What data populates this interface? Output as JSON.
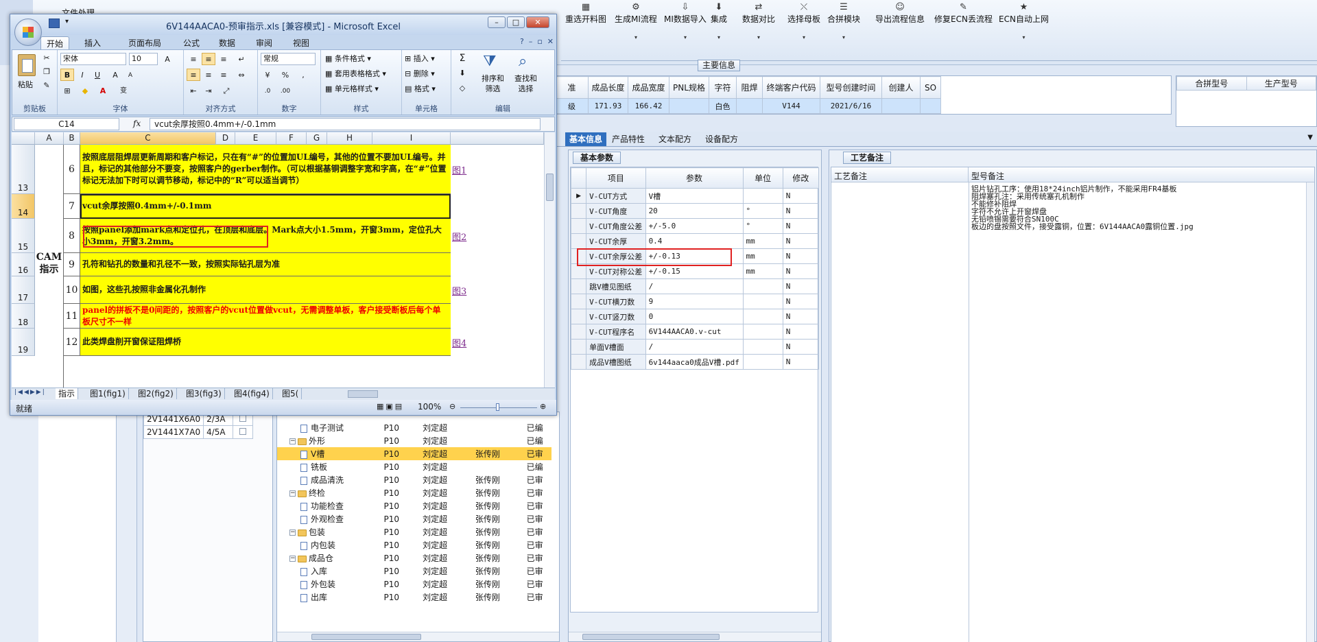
{
  "bg_app": {
    "menu_label": "文件处理",
    "toolbar": [
      "重选开料图",
      "生成MI流程",
      "MI数据导入",
      "集成",
      "数据对比",
      "选择母板",
      "合拼模块",
      "导出流程信息",
      "修复ECN丢流程",
      "ECN自动上网"
    ],
    "main_info_label": "主要信息",
    "info_headers": [
      "准",
      "成品长度",
      "成品宽度",
      "PNL规格",
      "字符",
      "阻焊",
      "终端客户代码",
      "型号创建时间",
      "创建人",
      "SO"
    ],
    "info_row": [
      "级",
      "171.93",
      "166.42",
      "",
      "白色",
      "",
      "V144",
      "2021/6/16",
      "",
      ""
    ],
    "right_headers": [
      "合拼型号",
      "生产型号"
    ],
    "detail_tabs": [
      "基本信息",
      "产品特性",
      "文本配方",
      "设备配方"
    ],
    "basic_params_title": "基本参数",
    "params_headers": [
      "项目",
      "参数",
      "单位",
      "修改"
    ],
    "params": [
      [
        "V-CUT方式",
        "V槽",
        "",
        "N"
      ],
      [
        "V-CUT角度",
        "20",
        "°",
        "N"
      ],
      [
        "V-CUT角度公差",
        "+/-5.0",
        "°",
        "N"
      ],
      [
        "V-CUT余厚",
        "0.4",
        "mm",
        "N"
      ],
      [
        "V-CUT余厚公差",
        "+/-0.13",
        "mm",
        "N"
      ],
      [
        "V-CUT对称公差",
        "+/-0.15",
        "mm",
        "N"
      ],
      [
        "跳V槽见图纸",
        "/",
        "",
        "N"
      ],
      [
        "V-CUT横刀数",
        "9",
        "",
        "N"
      ],
      [
        "V-CUT竖刀数",
        "0",
        "",
        "N"
      ],
      [
        "V-CUT程序名",
        "6V144AACA0.v-cut",
        "",
        "N"
      ],
      [
        "单面V槽面",
        "/",
        "",
        "N"
      ],
      [
        "成品V槽图纸",
        "6v144aaca0成品V槽.pdf",
        "",
        "N"
      ]
    ],
    "craft_title": "工艺备注",
    "craft_headers": [
      "工艺备注",
      "型号备注"
    ],
    "model_notes": [
      "铝片钻孔工序：使用18*24inch铝片制作，不能采用FR4基板",
      "阻焊塞孔注：采用传统塞孔机制作",
      "不能修补阻焊",
      "字符不允许上开窗焊盘",
      "无铅喷锡需要符合SN100C",
      "板边的盘按照文件，接受露铜，位置：6V144AACA0露铜位置.jpg"
    ],
    "small_rows": [
      [
        "2V1441X6A0",
        "2/3A"
      ],
      [
        "2V1441X7A0",
        "4/5A"
      ]
    ],
    "tree": [
      {
        "name": "电子测试",
        "lvl": 2,
        "c1": "P10",
        "c2": "刘定超",
        "c3": "",
        "c4": "已编",
        "hl": false
      },
      {
        "name": "外形",
        "lvl": 1,
        "c1": "P10",
        "c2": "刘定超",
        "c3": "",
        "c4": "已编",
        "hl": false
      },
      {
        "name": "V槽",
        "lvl": 2,
        "c1": "P10",
        "c2": "刘定超",
        "c3": "张传刚",
        "c4": "已审",
        "hl": true
      },
      {
        "name": "铣板",
        "lvl": 2,
        "c1": "P10",
        "c2": "刘定超",
        "c3": "",
        "c4": "已编",
        "hl": false
      },
      {
        "name": "成品清洗",
        "lvl": 2,
        "c1": "P10",
        "c2": "刘定超",
        "c3": "张传刚",
        "c4": "已审",
        "hl": false
      },
      {
        "name": "终检",
        "lvl": 1,
        "c1": "P10",
        "c2": "刘定超",
        "c3": "张传刚",
        "c4": "已审",
        "hl": false
      },
      {
        "name": "功能检查",
        "lvl": 2,
        "c1": "P10",
        "c2": "刘定超",
        "c3": "张传刚",
        "c4": "已审",
        "hl": false
      },
      {
        "name": "外观检查",
        "lvl": 2,
        "c1": "P10",
        "c2": "刘定超",
        "c3": "张传刚",
        "c4": "已审",
        "hl": false
      },
      {
        "name": "包装",
        "lvl": 1,
        "c1": "P10",
        "c2": "刘定超",
        "c3": "张传刚",
        "c4": "已审",
        "hl": false
      },
      {
        "name": "内包装",
        "lvl": 2,
        "c1": "P10",
        "c2": "刘定超",
        "c3": "张传刚",
        "c4": "已审",
        "hl": false
      },
      {
        "name": "成品仓",
        "lvl": 1,
        "c1": "P10",
        "c2": "刘定超",
        "c3": "张传刚",
        "c4": "已审",
        "hl": false
      },
      {
        "name": "入库",
        "lvl": 2,
        "c1": "P10",
        "c2": "刘定超",
        "c3": "张传刚",
        "c4": "已审",
        "hl": false
      },
      {
        "name": "外包装",
        "lvl": 2,
        "c1": "P10",
        "c2": "刘定超",
        "c3": "张传刚",
        "c4": "已审",
        "hl": false
      },
      {
        "name": "出库",
        "lvl": 2,
        "c1": "P10",
        "c2": "刘定超",
        "c3": "张传刚",
        "c4": "已审",
        "hl": false
      }
    ]
  },
  "excel": {
    "title": "6V144AACA0-预审指示.xls  [兼容模式] - Microsoft Excel",
    "tabs": [
      "开始",
      "插入",
      "页面布局",
      "公式",
      "数据",
      "审阅",
      "视图"
    ],
    "clipboard": {
      "paste": "粘贴",
      "label": "剪贴板"
    },
    "font": {
      "name": "宋体",
      "size": "10",
      "label": "字体"
    },
    "align_label": "对齐方式",
    "number": {
      "format": "常规",
      "label": "数字",
      "pct": "%"
    },
    "styles": {
      "items": [
        "条件格式",
        "套用表格格式",
        "单元格样式"
      ],
      "label": "样式"
    },
    "cells": {
      "items": [
        "插入",
        "删除",
        "格式"
      ],
      "label": "单元格"
    },
    "edit": {
      "sort": "排序和\n筛选",
      "find": "查找和\n选择",
      "label": "编辑"
    },
    "namebox": "C14",
    "formula": "vcut余厚按照0.4mm+/-0.1mm",
    "columns": [
      "A",
      "B",
      "C",
      "D",
      "E",
      "F",
      "G",
      "H",
      "I"
    ],
    "cam_label": "CAM\n指示",
    "rows": [
      {
        "rn": "13",
        "num": "6",
        "text": "按照底层阻焊层更新周期和客户标记，只在有“#”的位置加UL编号，其他的位置不要加UL编号。并且，标记的其他部分不要变，按照客户的gerber制作。（可以根据基铜调整字宽和字高，在“#”位置标记无法加下时可以调节移动，标记中的“R”可以适当调节）",
        "link": "图1",
        "red": false
      },
      {
        "rn": "14",
        "num": "7",
        "text": "vcut余厚按照0.4mm+/-0.1mm",
        "link": "",
        "red": false
      },
      {
        "rn": "15",
        "num": "8",
        "text": "按照panel添加mark点和定位孔，在顶层和底层。Mark点大小1.5mm，开窗3mm，定位孔大小3mm，开窗3.2mm。",
        "link": "图2",
        "red": false
      },
      {
        "rn": "16",
        "num": "9",
        "text": "孔符和钻孔的数量和孔径不一致，按照实际钻孔层为准",
        "link": "",
        "red": false
      },
      {
        "rn": "17",
        "num": "10",
        "text": "如图，这些孔按照非金属化孔制作",
        "link": "图3",
        "red": false
      },
      {
        "rn": "18",
        "num": "11",
        "text": "panel的拼板不是0间距的，按照客户的vcut位置做vcut，无需调整单板，客户接受断板后每个单板尺寸不一样",
        "link": "",
        "red": true
      },
      {
        "rn": "19",
        "num": "12",
        "text": "此类焊盘削开窗保证阻焊桥",
        "link": "图4",
        "red": false
      }
    ],
    "sheet_tabs": [
      "指示",
      "图1(fig1)",
      "图2(fig2)",
      "图3(fig3)",
      "图4(fig4)",
      "图5("
    ],
    "status": "就绪",
    "zoom": "100%"
  }
}
